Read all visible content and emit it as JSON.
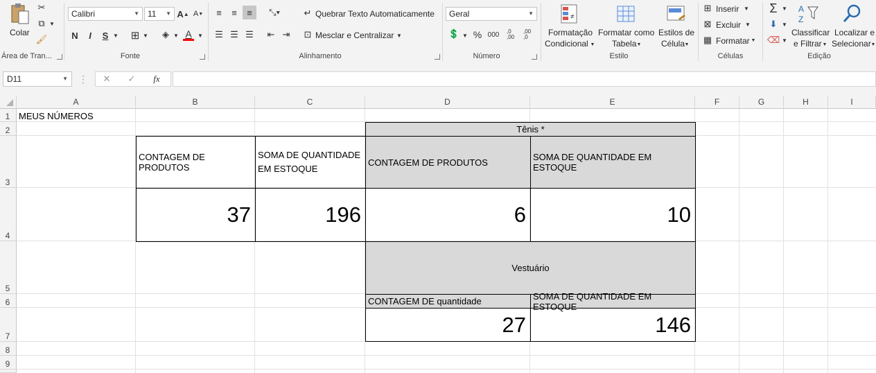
{
  "ribbon": {
    "clipboard": {
      "paste_label": "Colar",
      "group_label": "Área de Tran..."
    },
    "font": {
      "font_name": "Calibri",
      "font_size": "11",
      "bold": "N",
      "italic": "I",
      "underline": "S",
      "grow": "A",
      "shrink": "A",
      "font_color_glyph": "A",
      "group_label": "Fonte"
    },
    "alignment": {
      "wrap_text": "Quebrar Texto Automaticamente",
      "merge_center": "Mesclar e Centralizar",
      "group_label": "Alinhamento"
    },
    "number": {
      "format": "Geral",
      "percent": "%",
      "thousands": "000",
      "inc_dec": ",0 ,00",
      "dec_dec": ",00 ,0",
      "group_label": "Número"
    },
    "styles": {
      "conditional_l1": "Formatação",
      "conditional_l2": "Condicional",
      "table_l1": "Formatar como",
      "table_l2": "Tabela",
      "cell_styles_l1": "Estilos de",
      "cell_styles_l2": "Célula",
      "group_label": "Estilo"
    },
    "cells": {
      "insert": "Inserir",
      "delete": "Excluir",
      "format": "Formatar",
      "group_label": "Células"
    },
    "editing": {
      "sort_l1": "Classificar",
      "sort_l2": "e Filtrar",
      "find_l1": "Localizar e",
      "find_l2": "Selecionar",
      "group_label": "Edição"
    }
  },
  "formula_bar": {
    "name_box": "D11",
    "fx": "fx",
    "cancel": "✕",
    "enter": "✓",
    "formula": ""
  },
  "columns": [
    "A",
    "B",
    "C",
    "D",
    "E",
    "F",
    "G",
    "H",
    "I"
  ],
  "rows": [
    "1",
    "2",
    "3",
    "4",
    "5",
    "6",
    "7",
    "8",
    "9"
  ],
  "cells": {
    "A1": "MEUS NÚMEROS",
    "B3": "CONTAGEM DE PRODUTOS",
    "C3": "SOMA DE QUANTIDADE EM ESTOQUE",
    "B4": "37",
    "C4": "196",
    "D2": "Tênis *",
    "D3": "CONTAGEM DE PRODUTOS",
    "E3": "SOMA DE QUANTIDADE EM ESTOQUE",
    "D4": "6",
    "E4": "10",
    "D5": "Vestuário",
    "D6": "CONTAGEM DE quantidade",
    "E6": "SOMA DE QUANTIDADE EM ESTOQUE",
    "D7": "27",
    "E7": "146"
  },
  "colors": {
    "header_fill": "#d9d9d9",
    "ribbon_bg": "#f3f3f3",
    "font_color_bar": "#ff0000"
  }
}
